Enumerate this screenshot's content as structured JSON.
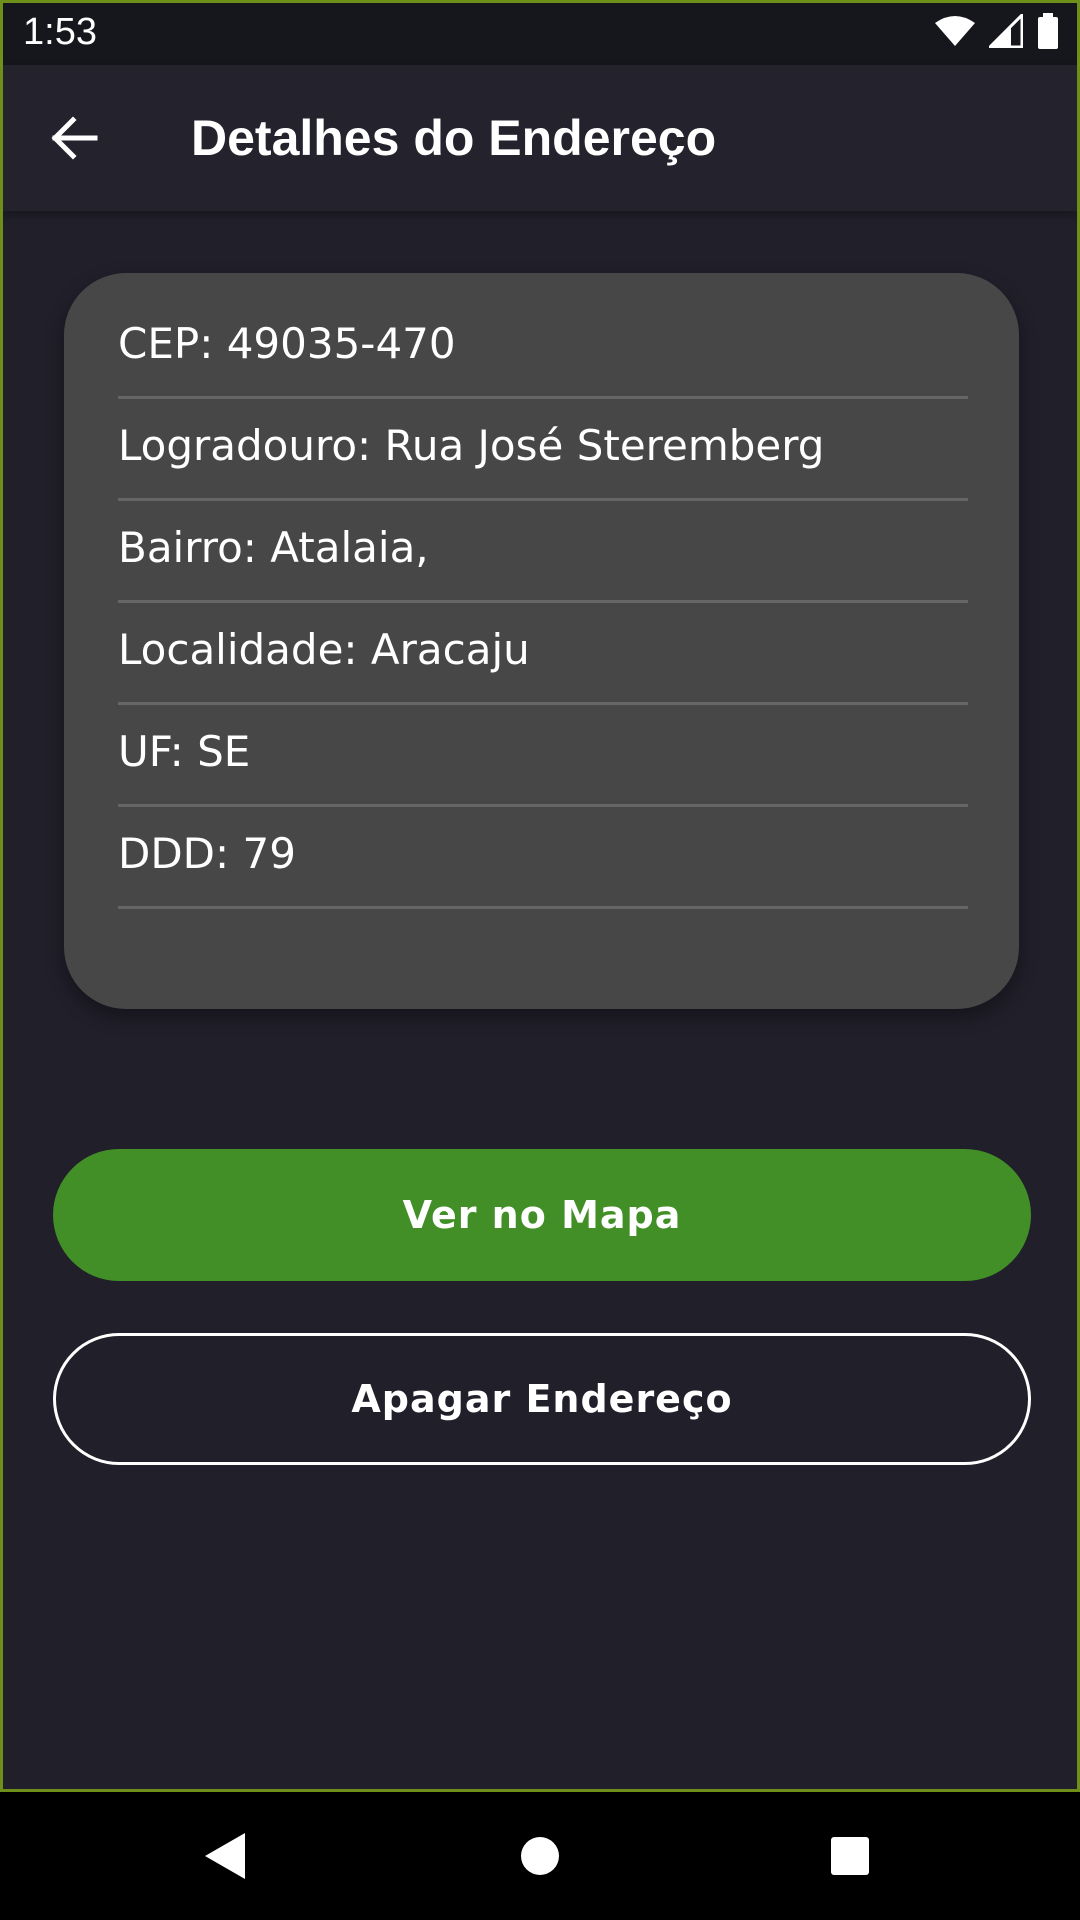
{
  "status_bar": {
    "time": "1:53",
    "icons": [
      "wifi-icon",
      "signal-icon",
      "battery-icon"
    ]
  },
  "app_bar": {
    "back_icon": "arrow-left-icon",
    "title": "Detalhes do Endereço"
  },
  "address": {
    "fields": [
      {
        "label": "CEP: 49035-470"
      },
      {
        "label": "Logradouro: Rua José Steremberg"
      },
      {
        "label": "Bairro: Atalaia,"
      },
      {
        "label": "Localidade: Aracaju"
      },
      {
        "label": "UF: SE"
      },
      {
        "label": "DDD: 79"
      }
    ]
  },
  "actions": {
    "map_label": "Ver no Mapa",
    "delete_label": "Apagar Endereço"
  },
  "colors": {
    "background": "#201f2a",
    "card": "#474747",
    "primary": "#428f27",
    "text": "#ffffff"
  },
  "nav_bar": {
    "icons": [
      "nav-back-icon",
      "nav-home-icon",
      "nav-recents-icon"
    ]
  }
}
